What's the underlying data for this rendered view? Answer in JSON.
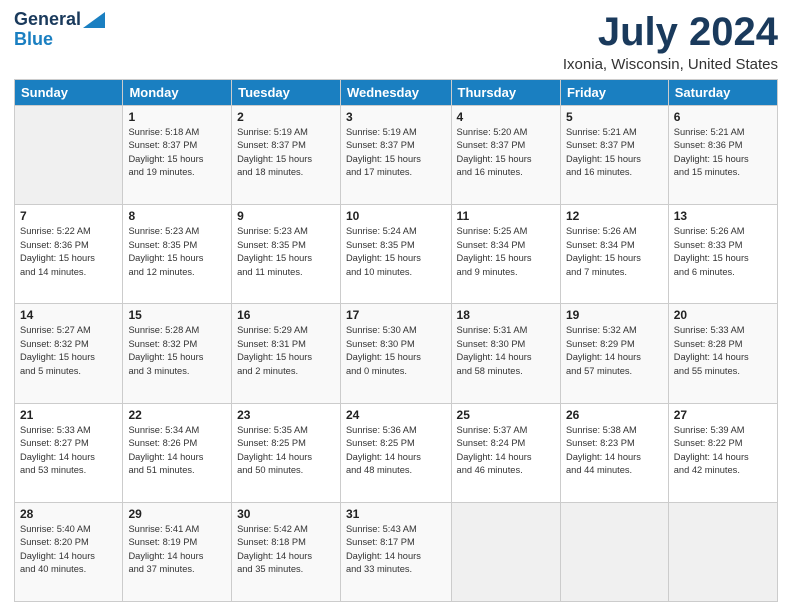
{
  "header": {
    "logo_line1": "General",
    "logo_line2": "Blue",
    "month": "July 2024",
    "location": "Ixonia, Wisconsin, United States"
  },
  "weekdays": [
    "Sunday",
    "Monday",
    "Tuesday",
    "Wednesday",
    "Thursday",
    "Friday",
    "Saturday"
  ],
  "weeks": [
    [
      {
        "day": "",
        "info": ""
      },
      {
        "day": "1",
        "info": "Sunrise: 5:18 AM\nSunset: 8:37 PM\nDaylight: 15 hours\nand 19 minutes."
      },
      {
        "day": "2",
        "info": "Sunrise: 5:19 AM\nSunset: 8:37 PM\nDaylight: 15 hours\nand 18 minutes."
      },
      {
        "day": "3",
        "info": "Sunrise: 5:19 AM\nSunset: 8:37 PM\nDaylight: 15 hours\nand 17 minutes."
      },
      {
        "day": "4",
        "info": "Sunrise: 5:20 AM\nSunset: 8:37 PM\nDaylight: 15 hours\nand 16 minutes."
      },
      {
        "day": "5",
        "info": "Sunrise: 5:21 AM\nSunset: 8:37 PM\nDaylight: 15 hours\nand 16 minutes."
      },
      {
        "day": "6",
        "info": "Sunrise: 5:21 AM\nSunset: 8:36 PM\nDaylight: 15 hours\nand 15 minutes."
      }
    ],
    [
      {
        "day": "7",
        "info": "Sunrise: 5:22 AM\nSunset: 8:36 PM\nDaylight: 15 hours\nand 14 minutes."
      },
      {
        "day": "8",
        "info": "Sunrise: 5:23 AM\nSunset: 8:35 PM\nDaylight: 15 hours\nand 12 minutes."
      },
      {
        "day": "9",
        "info": "Sunrise: 5:23 AM\nSunset: 8:35 PM\nDaylight: 15 hours\nand 11 minutes."
      },
      {
        "day": "10",
        "info": "Sunrise: 5:24 AM\nSunset: 8:35 PM\nDaylight: 15 hours\nand 10 minutes."
      },
      {
        "day": "11",
        "info": "Sunrise: 5:25 AM\nSunset: 8:34 PM\nDaylight: 15 hours\nand 9 minutes."
      },
      {
        "day": "12",
        "info": "Sunrise: 5:26 AM\nSunset: 8:34 PM\nDaylight: 15 hours\nand 7 minutes."
      },
      {
        "day": "13",
        "info": "Sunrise: 5:26 AM\nSunset: 8:33 PM\nDaylight: 15 hours\nand 6 minutes."
      }
    ],
    [
      {
        "day": "14",
        "info": "Sunrise: 5:27 AM\nSunset: 8:32 PM\nDaylight: 15 hours\nand 5 minutes."
      },
      {
        "day": "15",
        "info": "Sunrise: 5:28 AM\nSunset: 8:32 PM\nDaylight: 15 hours\nand 3 minutes."
      },
      {
        "day": "16",
        "info": "Sunrise: 5:29 AM\nSunset: 8:31 PM\nDaylight: 15 hours\nand 2 minutes."
      },
      {
        "day": "17",
        "info": "Sunrise: 5:30 AM\nSunset: 8:30 PM\nDaylight: 15 hours\nand 0 minutes."
      },
      {
        "day": "18",
        "info": "Sunrise: 5:31 AM\nSunset: 8:30 PM\nDaylight: 14 hours\nand 58 minutes."
      },
      {
        "day": "19",
        "info": "Sunrise: 5:32 AM\nSunset: 8:29 PM\nDaylight: 14 hours\nand 57 minutes."
      },
      {
        "day": "20",
        "info": "Sunrise: 5:33 AM\nSunset: 8:28 PM\nDaylight: 14 hours\nand 55 minutes."
      }
    ],
    [
      {
        "day": "21",
        "info": "Sunrise: 5:33 AM\nSunset: 8:27 PM\nDaylight: 14 hours\nand 53 minutes."
      },
      {
        "day": "22",
        "info": "Sunrise: 5:34 AM\nSunset: 8:26 PM\nDaylight: 14 hours\nand 51 minutes."
      },
      {
        "day": "23",
        "info": "Sunrise: 5:35 AM\nSunset: 8:25 PM\nDaylight: 14 hours\nand 50 minutes."
      },
      {
        "day": "24",
        "info": "Sunrise: 5:36 AM\nSunset: 8:25 PM\nDaylight: 14 hours\nand 48 minutes."
      },
      {
        "day": "25",
        "info": "Sunrise: 5:37 AM\nSunset: 8:24 PM\nDaylight: 14 hours\nand 46 minutes."
      },
      {
        "day": "26",
        "info": "Sunrise: 5:38 AM\nSunset: 8:23 PM\nDaylight: 14 hours\nand 44 minutes."
      },
      {
        "day": "27",
        "info": "Sunrise: 5:39 AM\nSunset: 8:22 PM\nDaylight: 14 hours\nand 42 minutes."
      }
    ],
    [
      {
        "day": "28",
        "info": "Sunrise: 5:40 AM\nSunset: 8:20 PM\nDaylight: 14 hours\nand 40 minutes."
      },
      {
        "day": "29",
        "info": "Sunrise: 5:41 AM\nSunset: 8:19 PM\nDaylight: 14 hours\nand 37 minutes."
      },
      {
        "day": "30",
        "info": "Sunrise: 5:42 AM\nSunset: 8:18 PM\nDaylight: 14 hours\nand 35 minutes."
      },
      {
        "day": "31",
        "info": "Sunrise: 5:43 AM\nSunset: 8:17 PM\nDaylight: 14 hours\nand 33 minutes."
      },
      {
        "day": "",
        "info": ""
      },
      {
        "day": "",
        "info": ""
      },
      {
        "day": "",
        "info": ""
      }
    ]
  ]
}
